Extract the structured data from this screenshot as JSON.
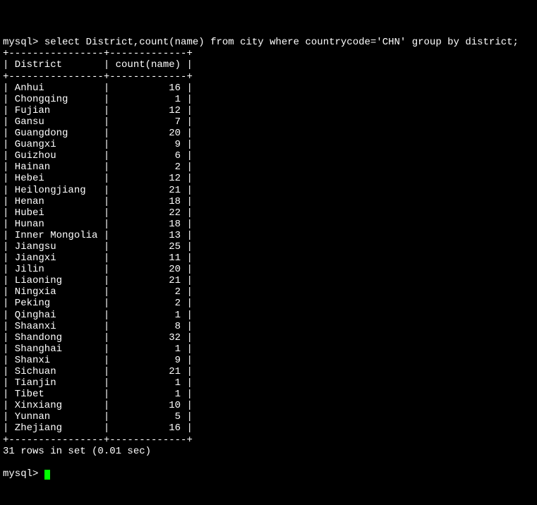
{
  "prompt": "mysql>",
  "query": "select District,count(name) from city where countrycode='CHN' group by district;",
  "table": {
    "border_top": "+----------------+-------------+",
    "header_row": "| District       | count(name) |",
    "border_mid": "+----------------+-------------+",
    "rows": [
      {
        "district": "Anhui",
        "count": 16
      },
      {
        "district": "Chongqing",
        "count": 1
      },
      {
        "district": "Fujian",
        "count": 12
      },
      {
        "district": "Gansu",
        "count": 7
      },
      {
        "district": "Guangdong",
        "count": 20
      },
      {
        "district": "Guangxi",
        "count": 9
      },
      {
        "district": "Guizhou",
        "count": 6
      },
      {
        "district": "Hainan",
        "count": 2
      },
      {
        "district": "Hebei",
        "count": 12
      },
      {
        "district": "Heilongjiang",
        "count": 21
      },
      {
        "district": "Henan",
        "count": 18
      },
      {
        "district": "Hubei",
        "count": 22
      },
      {
        "district": "Hunan",
        "count": 18
      },
      {
        "district": "Inner Mongolia",
        "count": 13
      },
      {
        "district": "Jiangsu",
        "count": 25
      },
      {
        "district": "Jiangxi",
        "count": 11
      },
      {
        "district": "Jilin",
        "count": 20
      },
      {
        "district": "Liaoning",
        "count": 21
      },
      {
        "district": "Ningxia",
        "count": 2
      },
      {
        "district": "Peking",
        "count": 2
      },
      {
        "district": "Qinghai",
        "count": 1
      },
      {
        "district": "Shaanxi",
        "count": 8
      },
      {
        "district": "Shandong",
        "count": 32
      },
      {
        "district": "Shanghai",
        "count": 1
      },
      {
        "district": "Shanxi",
        "count": 9
      },
      {
        "district": "Sichuan",
        "count": 21
      },
      {
        "district": "Tianjin",
        "count": 1
      },
      {
        "district": "Tibet",
        "count": 1
      },
      {
        "district": "Xinxiang",
        "count": 10
      },
      {
        "district": "Yunnan",
        "count": 5
      },
      {
        "district": "Zhejiang",
        "count": 16
      }
    ],
    "border_bottom": "+----------------+-------------+"
  },
  "result_status": "31 rows in set (0.01 sec)",
  "prompt2": "mysql>"
}
